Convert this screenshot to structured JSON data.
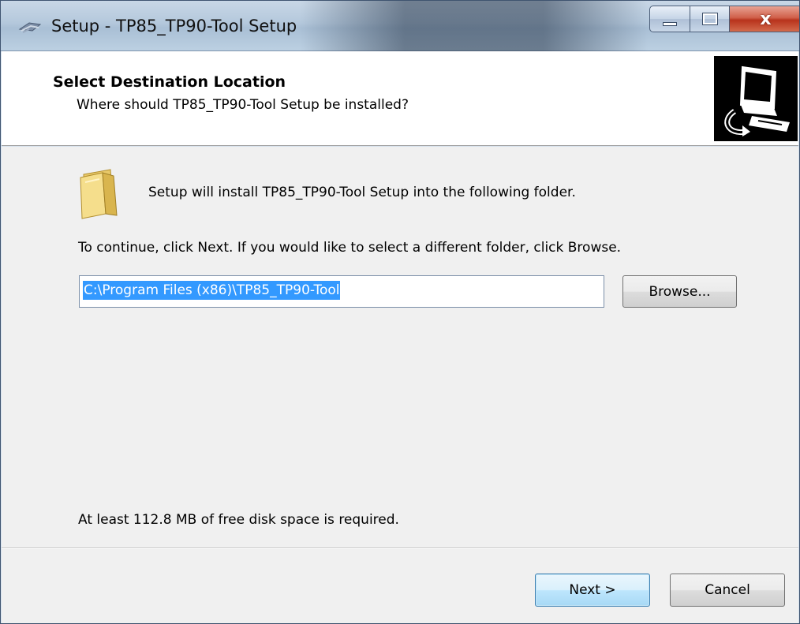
{
  "window": {
    "title": "Setup - TP85_TP90-Tool Setup",
    "close_glyph": "x"
  },
  "header": {
    "title": "Select Destination Location",
    "subtitle": "Where should TP85_TP90-Tool Setup be installed?"
  },
  "body": {
    "install_message": "Setup will install TP85_TP90-Tool Setup into the following folder.",
    "continue_message": "To continue, click Next. If you would like to select a different folder, click Browse.",
    "path_value": "C:\\Program Files (x86)\\TP85_TP90-Tool",
    "browse_label": "Browse...",
    "disk_space_message": "At least 112.8 MB of free disk space is required."
  },
  "footer": {
    "next_label": "Next >",
    "cancel_label": "Cancel"
  },
  "icons": {
    "app": "setup-app-icon",
    "folder": "folder-icon",
    "header_image": "computer-install-icon",
    "minimize": "minimize-icon",
    "maximize": "maximize-icon",
    "close": "close-icon"
  },
  "colors": {
    "selection": "#3399ff",
    "close_button": "#c7462f",
    "next_button": "#bee6fd"
  }
}
